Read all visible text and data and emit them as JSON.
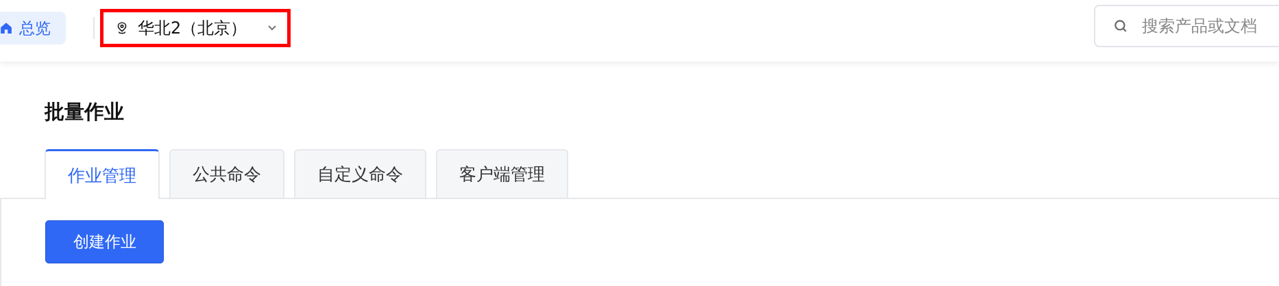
{
  "header": {
    "home_button": {
      "label": "总览"
    },
    "region_selector": {
      "label": "华北2（北京）",
      "highlighted": true
    },
    "search": {
      "placeholder": "搜索产品或文档"
    }
  },
  "page_title": "批量作业",
  "tabs": [
    {
      "label": "作业管理",
      "selected": true
    },
    {
      "label": "公共命令",
      "selected": false
    },
    {
      "label": "自定义命令",
      "selected": false
    },
    {
      "label": "客户端管理",
      "selected": false
    }
  ],
  "create_button": "创建作业"
}
